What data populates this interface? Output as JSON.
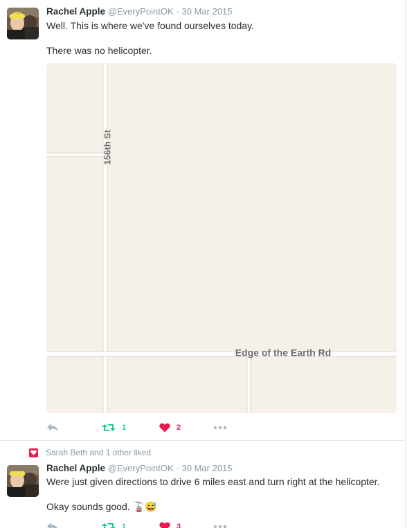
{
  "tweets": [
    {
      "name": "Rachel Apple",
      "handle": "@EveryPointOK",
      "separator": "·",
      "date": "30 Mar 2015",
      "text_lines": [
        "Well. This is where we've found ourselves today.",
        "There was no helicopter."
      ],
      "map": {
        "labels": [
          "156th St",
          "Edge of the Earth Rd"
        ]
      },
      "actions": {
        "reply_icon": "reply-icon",
        "retweet_icon": "retweet-icon",
        "retweet_count": "1",
        "like_icon": "heart-icon",
        "like_count": "2",
        "more_icon": "more-icon"
      }
    },
    {
      "social_context": "Sarah Beth and 1 other liked",
      "name": "Rachel Apple",
      "handle": "@EveryPointOK",
      "separator": "·",
      "date": "30 Mar 2015",
      "text_lines": [
        "Were just given directions to drive 6 miles east and turn right at the helicopter.",
        "Okay sounds good. 🚡😅"
      ],
      "actions": {
        "retweet_count": "1",
        "like_count": "3"
      }
    }
  ],
  "colors": {
    "name": "#292f33",
    "meta": "#8899a6",
    "retweet": "#19cf86",
    "like": "#e81c4f",
    "map_bg": "#f5f1e9",
    "road": "#ffffff"
  }
}
